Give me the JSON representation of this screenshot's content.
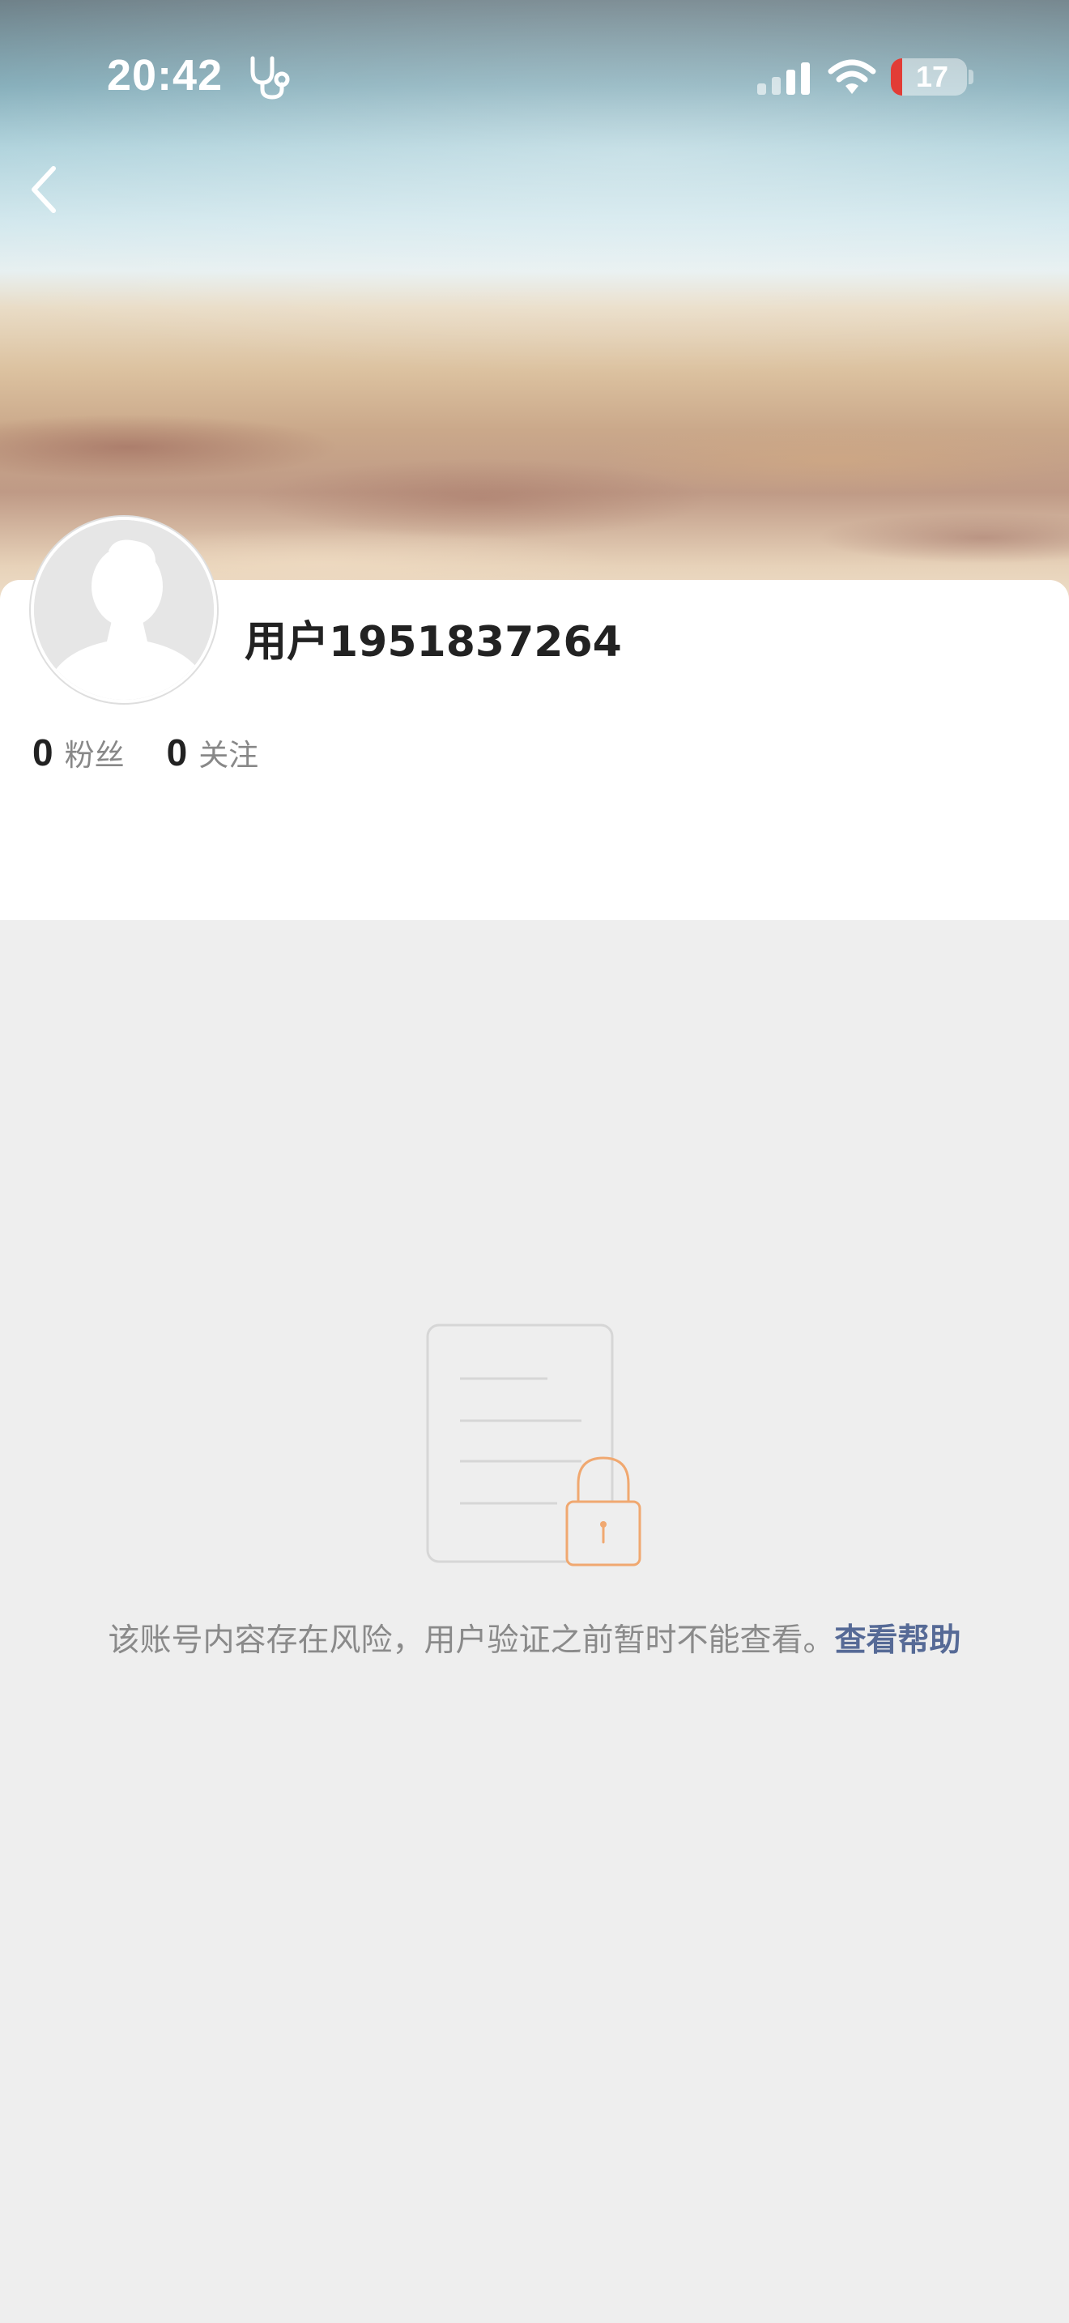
{
  "status_bar": {
    "time": "20:42",
    "battery_percent": "17",
    "icons": [
      "stethoscope-icon",
      "cellular-signal-icon",
      "wifi-icon",
      "battery-icon"
    ]
  },
  "navigation": {
    "back_icon": "chevron-left-icon"
  },
  "profile": {
    "username": "用户1951837264",
    "avatar_icon": "default-avatar-silhouette",
    "stats": [
      {
        "count": "0",
        "label": "粉丝"
      },
      {
        "count": "0",
        "label": "关注"
      }
    ]
  },
  "empty_state": {
    "icon": "locked-document-icon",
    "message": "该账号内容存在风险，用户验证之前暂时不能查看。",
    "help_link": "查看帮助"
  },
  "colors": {
    "page_background": "#eeeeee",
    "card_background": "#ffffff",
    "link": "#566a96",
    "lock_accent": "#f0a870",
    "battery_low": "#e23c36"
  }
}
